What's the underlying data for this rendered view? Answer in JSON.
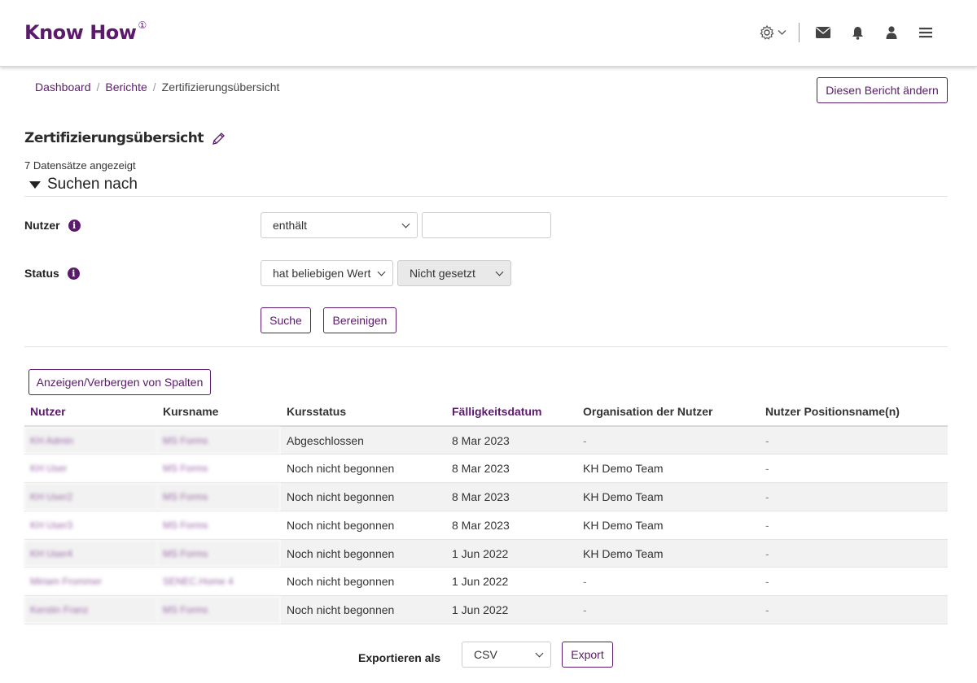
{
  "header": {
    "logo": "Know How",
    "logo_mark": "①",
    "icons": [
      "gear-icon",
      "chevron-down-icon",
      "envelope-icon",
      "bell-icon",
      "user-icon",
      "menu-icon"
    ]
  },
  "breadcrumb": {
    "items": [
      "Dashboard",
      "Berichte"
    ],
    "current": "Zertifizierungsübersicht"
  },
  "edit_report_button": "Diesen Bericht ändern",
  "page": {
    "title": "Zertifizierungsübersicht",
    "records": "7 Datensätze angezeigt",
    "search_toggle": "Suchen nach"
  },
  "filters": {
    "user": {
      "label": "Nutzer",
      "operator": "enthält",
      "value": ""
    },
    "status": {
      "label": "Status",
      "operator": "hat beliebigen Wert",
      "value": "Nicht gesetzt"
    },
    "search_button": "Suche",
    "clear_button": "Bereinigen"
  },
  "columns_button": "Anzeigen/Verbergen von Spalten",
  "table": {
    "headers": [
      "Nutzer",
      "Kursname",
      "Kursstatus",
      "Fälligkeitsdatum",
      "Organisation der Nutzer",
      "Nutzer Positionsname(n)"
    ],
    "rows": [
      [
        "KH Admin",
        "MS Forms",
        "Abgeschlossen",
        "8 Mar 2023",
        "-",
        "-"
      ],
      [
        "KH User",
        "MS Forms",
        "Noch nicht begonnen",
        "8 Mar 2023",
        "KH Demo Team",
        "-"
      ],
      [
        "KH User2",
        "MS Forms",
        "Noch nicht begonnen",
        "8 Mar 2023",
        "KH Demo Team",
        "-"
      ],
      [
        "KH User3",
        "MS Forms",
        "Noch nicht begonnen",
        "8 Mar 2023",
        "KH Demo Team",
        "-"
      ],
      [
        "KH User4",
        "MS Forms",
        "Noch nicht begonnen",
        "1 Jun 2022",
        "KH Demo Team",
        "-"
      ],
      [
        "Miriam Frommer",
        "SENEC.Home 4",
        "Noch nicht begonnen",
        "1 Jun 2022",
        "-",
        "-"
      ],
      [
        "Kerstin Franz",
        "MS Forms",
        "Noch nicht begonnen",
        "1 Jun 2022",
        "-",
        "-"
      ]
    ]
  },
  "export": {
    "label": "Exportieren als",
    "format": "CSV",
    "button": "Export"
  },
  "colors": {
    "accent": "#5b1a6b"
  }
}
